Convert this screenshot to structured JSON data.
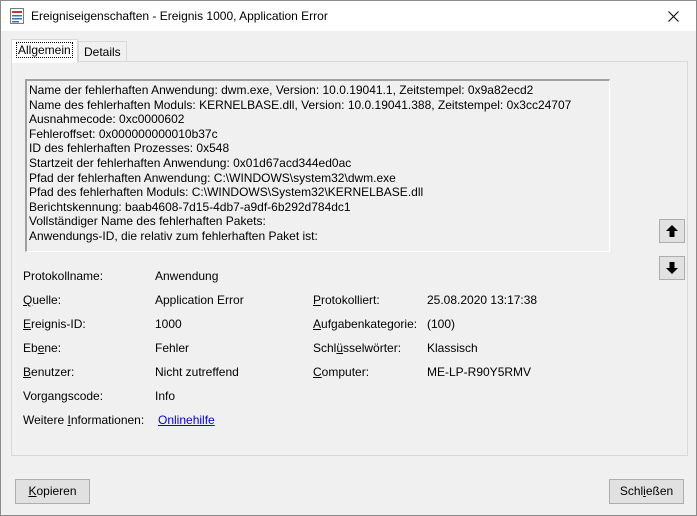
{
  "window": {
    "title": "Ereigniseigenschaften - Ereignis 1000, Application Error"
  },
  "tabs": [
    {
      "label": "Allgemein"
    },
    {
      "label": "Details"
    }
  ],
  "description_lines": [
    "Name der fehlerhaften Anwendung: dwm.exe, Version: 10.0.19041.1, Zeitstempel: 0x9a82ecd2",
    "Name des fehlerhaften Moduls: KERNELBASE.dll, Version: 10.0.19041.388, Zeitstempel: 0x3cc24707",
    "Ausnahmecode: 0xc0000602",
    "Fehleroffset: 0x000000000010b37c",
    "ID des fehlerhaften Prozesses: 0x548",
    "Startzeit der fehlerhaften Anwendung: 0x01d67acd344ed0ac",
    "Pfad der fehlerhaften Anwendung: C:\\WINDOWS\\system32\\dwm.exe",
    "Pfad des fehlerhaften Moduls: C:\\WINDOWS\\System32\\KERNELBASE.dll",
    "Berichtskennung: baab4608-7d15-4db7-a9df-6b292d784dc1",
    "Vollständiger Name des fehlerhaften Pakets:",
    "Anwendungs-ID, die relativ zum fehlerhaften Paket ist:"
  ],
  "fields": {
    "protokollname": {
      "label": "Protokollname:",
      "value": "Anwendung"
    },
    "quelle": {
      "label_u": "Q",
      "label_rest": "uelle:",
      "value": "Application Error"
    },
    "protokolliert": {
      "label_u": "P",
      "label_rest": "rotokolliert:",
      "value": "25.08.2020 13:17:38"
    },
    "ereignis_id": {
      "label_u": "E",
      "label_rest": "reignis-ID:",
      "value": "1000"
    },
    "aufgabenkategorie": {
      "label_u": "A",
      "label_rest": "ufgabenkategorie:",
      "value": "(100)"
    },
    "ebene": {
      "label_pre": "Eb",
      "label_u": "e",
      "label_rest": "ne:",
      "value": "Fehler"
    },
    "schluesselwoerter": {
      "label_pre": "Schl",
      "label_u": "ü",
      "label_rest": "sselwörter:",
      "value": "Klassisch"
    },
    "benutzer": {
      "label_u": "B",
      "label_rest": "enutzer:",
      "value": "Nicht zutreffend"
    },
    "computer": {
      "label_u": "C",
      "label_rest": "omputer:",
      "value": "ME-LP-R90Y5RMV"
    },
    "vorgangscode": {
      "label": "Vorgangscode:",
      "value": "Info"
    },
    "weitere_informationen": {
      "label_pre": "Weitere ",
      "label_u": "I",
      "label_rest": "nformationen:",
      "link": "Onlinehilfe"
    }
  },
  "buttons": {
    "copy": {
      "label_u": "K",
      "label_rest": "opieren"
    },
    "close": {
      "label_pre": "Schl",
      "label_u": "i",
      "label_rest": "eßen"
    }
  },
  "icons": {
    "app": "event-log-icon",
    "close": "close-icon",
    "up": "arrow-up-icon",
    "down": "arrow-down-icon"
  }
}
